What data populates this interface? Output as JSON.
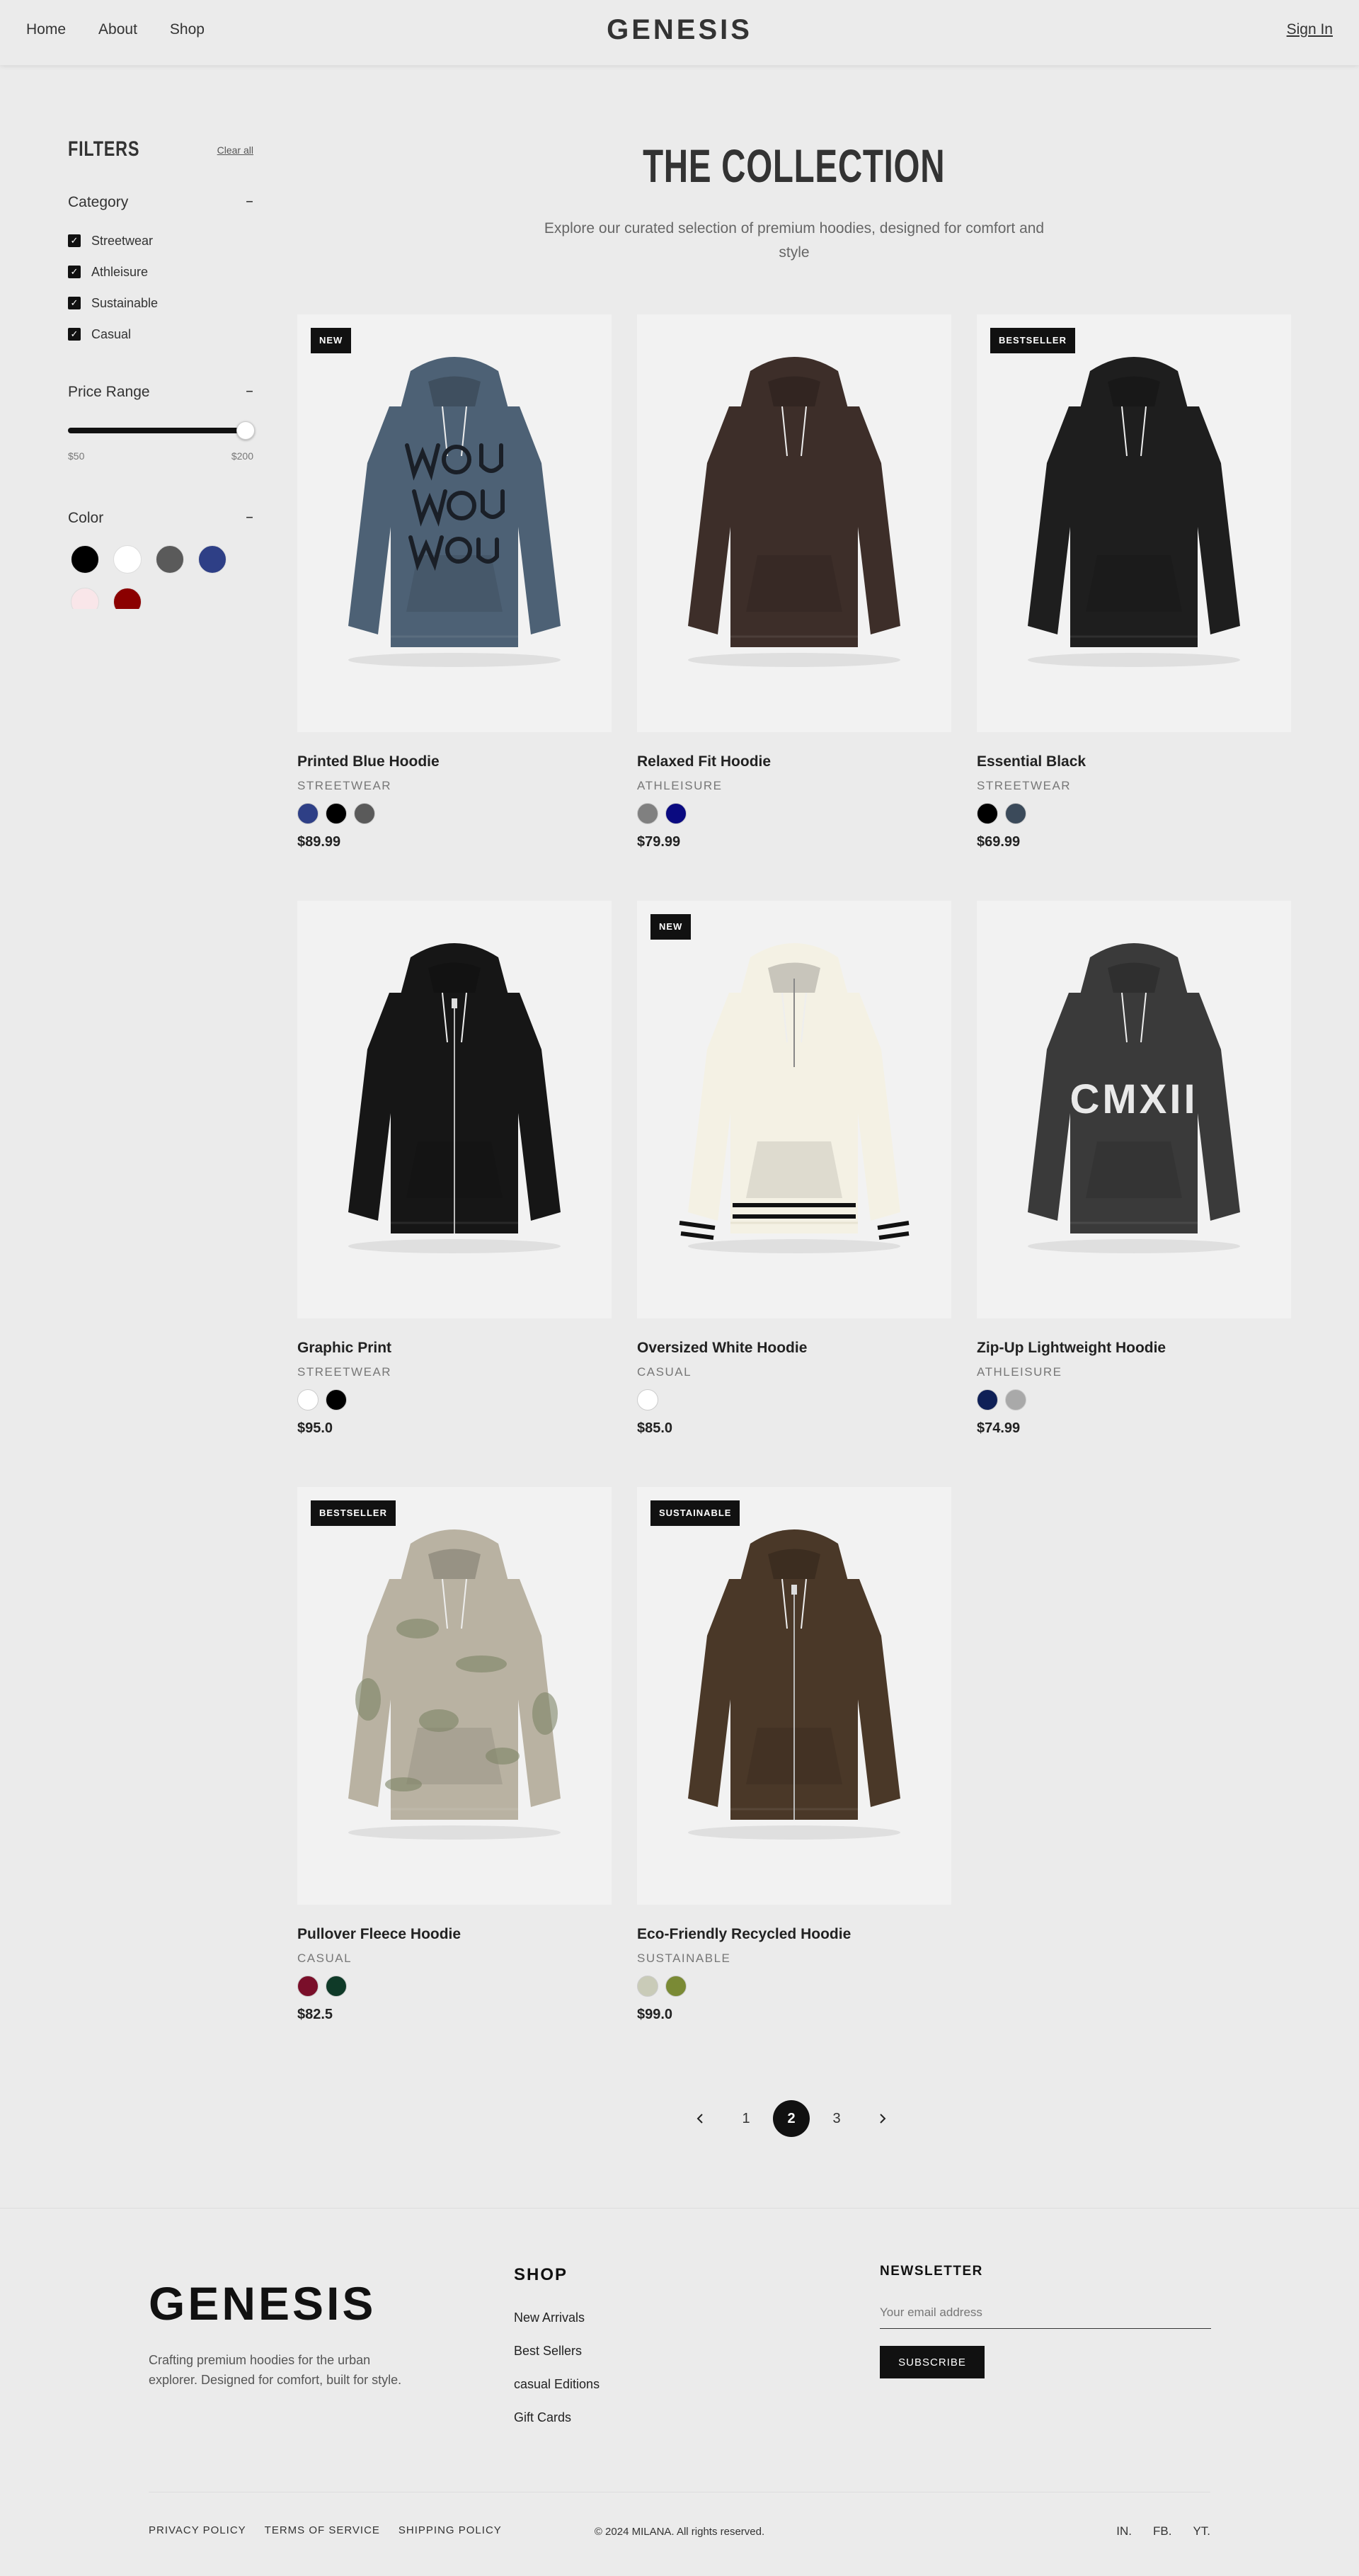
{
  "header": {
    "nav": [
      "Home",
      "About",
      "Shop"
    ],
    "brand": "GENESIS",
    "signin": "Sign In"
  },
  "sidebar": {
    "title": "FILTERS",
    "clear_all": "Clear all",
    "category": {
      "title": "Category",
      "collapse": "–",
      "items": [
        "Streetwear",
        "Athleisure",
        "Sustainable",
        "Casual"
      ],
      "checkmark": "✓"
    },
    "price": {
      "title": "Price Range",
      "collapse": "–",
      "min_label": "$50",
      "max_label": "$200",
      "slider_value_fraction": 1.0
    },
    "color": {
      "title": "Color",
      "collapse": "–",
      "swatches": [
        "#000000",
        "#ffffff",
        "#5a5a5a",
        "#2e3f86",
        "#f9e6e9",
        "#8b0000"
      ]
    }
  },
  "main": {
    "title": "THE COLLECTION",
    "subtitle": "Explore our curated selection of premium hoodies, designed for comfort and style"
  },
  "products": [
    {
      "name": "Printed Blue Hoodie",
      "category": "STREETWEAR",
      "price": "$89.99",
      "badge": "NEW",
      "colors": [
        "#2e3f86",
        "#000000",
        "#5a5a5a"
      ],
      "garment": "#4d6175",
      "style": "print-wou"
    },
    {
      "name": "Relaxed Fit Hoodie",
      "category": "ATHLEISURE",
      "price": "$79.99",
      "badge": "",
      "colors": [
        "#808080",
        "#0a0a80"
      ],
      "garment": "#3d2e29",
      "style": "plain"
    },
    {
      "name": "Essential Black",
      "category": "STREETWEAR",
      "price": "$69.99",
      "badge": "BESTSELLER",
      "colors": [
        "#000000",
        "#3b4a5a"
      ],
      "garment": "#1e1e1e",
      "style": "plain"
    },
    {
      "name": "Graphic Print",
      "category": "STREETWEAR",
      "price": "$95.0",
      "badge": "",
      "colors": [
        "#ffffff",
        "#000000"
      ],
      "garment": "#161616",
      "style": "zip"
    },
    {
      "name": "Oversized White Hoodie",
      "category": "CASUAL",
      "price": "$85.0",
      "badge": "NEW",
      "colors": [
        "#ffffff"
      ],
      "garment": "#f4f1e4",
      "style": "half-zip"
    },
    {
      "name": "Zip-Up Lightweight Hoodie",
      "category": "ATHLEISURE",
      "price": "$74.99",
      "badge": "",
      "colors": [
        "#0f2057",
        "#a9a9a9"
      ],
      "garment": "#3a3a3a",
      "style": "print-cmxii",
      "print_text": "CMXII"
    },
    {
      "name": "Pullover Fleece Hoodie",
      "category": "CASUAL",
      "price": "$82.5",
      "badge": "BESTSELLER",
      "colors": [
        "#7a0f2a",
        "#0f3a28"
      ],
      "garment": "#b9b2a2",
      "style": "camo"
    },
    {
      "name": "Eco-Friendly Recycled Hoodie",
      "category": "SUSTAINABLE",
      "price": "$99.0",
      "badge": "SUSTAINABLE",
      "colors": [
        "#c9cbb8",
        "#7a8a35"
      ],
      "garment": "#4a3828",
      "style": "zip"
    }
  ],
  "pagination": {
    "pages": [
      "1",
      "2",
      "3"
    ],
    "active": "2"
  },
  "footer": {
    "brand": "GENESIS",
    "tagline": "Crafting premium hoodies for the urban explorer. Designed for comfort, built for style.",
    "shop_title": "SHOP",
    "shop_links": [
      "New Arrivals",
      "Best Sellers",
      "casual Editions",
      "Gift Cards"
    ],
    "newsletter_title": "NEWSLETTER",
    "email_placeholder": "Your email address",
    "subscribe": "SUBSCRIBE",
    "legal": [
      "PRIVACY POLICY",
      "TERMS OF SERVICE",
      "SHIPPING POLICY"
    ],
    "copyright": "© 2024 MILANA. All rights reserved.",
    "social": [
      "IN.",
      "FB.",
      "YT."
    ]
  }
}
